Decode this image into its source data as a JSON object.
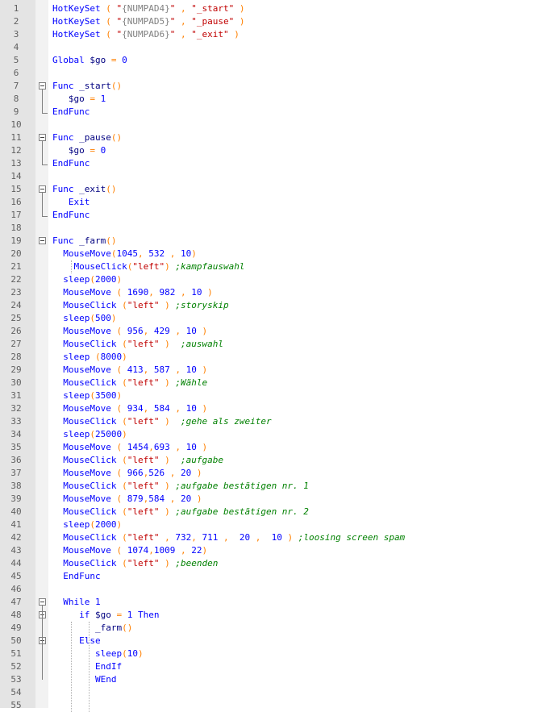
{
  "editor": {
    "lines": [
      {
        "n": "1",
        "parts": [
          [
            "k",
            "HotKeySet"
          ],
          [
            "sym",
            " ( "
          ],
          [
            "str",
            "\""
          ],
          [
            "grey",
            "{NUMPAD4}"
          ],
          [
            "str",
            "\""
          ],
          [
            "sym",
            " , "
          ],
          [
            "str",
            "\"_start\""
          ],
          [
            "sym",
            " )"
          ]
        ]
      },
      {
        "n": "2",
        "parts": [
          [
            "k",
            "HotKeySet"
          ],
          [
            "sym",
            " ( "
          ],
          [
            "str",
            "\""
          ],
          [
            "grey",
            "{NUMPAD5}"
          ],
          [
            "str",
            "\""
          ],
          [
            "sym",
            " , "
          ],
          [
            "str",
            "\"_pause\""
          ],
          [
            "sym",
            " )"
          ]
        ]
      },
      {
        "n": "3",
        "parts": [
          [
            "k",
            "HotKeySet"
          ],
          [
            "sym",
            " ( "
          ],
          [
            "str",
            "\""
          ],
          [
            "grey",
            "{NUMPAD6}"
          ],
          [
            "str",
            "\""
          ],
          [
            "sym",
            " , "
          ],
          [
            "str",
            "\"_exit\""
          ],
          [
            "sym",
            " )"
          ]
        ]
      },
      {
        "n": "4",
        "parts": []
      },
      {
        "n": "5",
        "parts": [
          [
            "k",
            "Global"
          ],
          [
            "var",
            " $go "
          ],
          [
            "sym",
            "="
          ],
          [
            "num",
            " 0"
          ]
        ]
      },
      {
        "n": "6",
        "parts": []
      },
      {
        "n": "7",
        "parts": [
          [
            "k",
            "Func"
          ],
          [
            "var",
            " _start"
          ],
          [
            "sym",
            "()"
          ]
        ]
      },
      {
        "n": "8",
        "parts": [
          [
            "var",
            "   $go "
          ],
          [
            "sym",
            "="
          ],
          [
            "num",
            " 1"
          ]
        ]
      },
      {
        "n": "9",
        "parts": [
          [
            "k",
            "EndFunc"
          ]
        ]
      },
      {
        "n": "10",
        "parts": []
      },
      {
        "n": "11",
        "parts": [
          [
            "k",
            "Func"
          ],
          [
            "var",
            " _pause"
          ],
          [
            "sym",
            "()"
          ]
        ]
      },
      {
        "n": "12",
        "parts": [
          [
            "var",
            "   $go "
          ],
          [
            "sym",
            "="
          ],
          [
            "num",
            " 0"
          ]
        ]
      },
      {
        "n": "13",
        "parts": [
          [
            "k",
            "EndFunc"
          ]
        ]
      },
      {
        "n": "14",
        "parts": []
      },
      {
        "n": "15",
        "parts": [
          [
            "k",
            "Func"
          ],
          [
            "var",
            " _exit"
          ],
          [
            "sym",
            "()"
          ]
        ]
      },
      {
        "n": "16",
        "parts": [
          [
            "k",
            "   Exit"
          ]
        ]
      },
      {
        "n": "17",
        "parts": [
          [
            "k",
            "EndFunc"
          ]
        ]
      },
      {
        "n": "18",
        "parts": []
      },
      {
        "n": "19",
        "parts": [
          [
            "k",
            "Func"
          ],
          [
            "var",
            " _farm"
          ],
          [
            "sym",
            "()"
          ]
        ]
      },
      {
        "n": "20",
        "parts": [
          [
            "k",
            "  MouseMove"
          ],
          [
            "sym",
            "("
          ],
          [
            "num",
            "1045"
          ],
          [
            "sym",
            ", "
          ],
          [
            "num",
            "532"
          ],
          [
            "sym",
            " , "
          ],
          [
            "num",
            "10"
          ],
          [
            "sym",
            ")"
          ]
        ]
      },
      {
        "n": "21",
        "parts": [
          [
            "k",
            "    MouseClick"
          ],
          [
            "sym",
            "("
          ],
          [
            "str",
            "\"left\""
          ],
          [
            "sym",
            ")"
          ],
          [
            "cmt",
            " ;kampfauswahl"
          ]
        ]
      },
      {
        "n": "22",
        "parts": [
          [
            "k",
            "  sleep"
          ],
          [
            "sym",
            "("
          ],
          [
            "num",
            "2000"
          ],
          [
            "sym",
            ")"
          ]
        ]
      },
      {
        "n": "23",
        "parts": [
          [
            "k",
            "  MouseMove"
          ],
          [
            "sym",
            " ( "
          ],
          [
            "num",
            "1690"
          ],
          [
            "sym",
            ", "
          ],
          [
            "num",
            "982"
          ],
          [
            "sym",
            " , "
          ],
          [
            "num",
            "10"
          ],
          [
            "sym",
            " )"
          ]
        ]
      },
      {
        "n": "24",
        "parts": [
          [
            "k",
            "  MouseClick"
          ],
          [
            "sym",
            " ("
          ],
          [
            "str",
            "\"left\""
          ],
          [
            "sym",
            " )"
          ],
          [
            "cmt",
            " ;storyskip"
          ]
        ]
      },
      {
        "n": "25",
        "parts": [
          [
            "k",
            "  sleep"
          ],
          [
            "sym",
            "("
          ],
          [
            "num",
            "500"
          ],
          [
            "sym",
            ")"
          ]
        ]
      },
      {
        "n": "26",
        "parts": [
          [
            "k",
            "  MouseMove"
          ],
          [
            "sym",
            " ( "
          ],
          [
            "num",
            "956"
          ],
          [
            "sym",
            ", "
          ],
          [
            "num",
            "429"
          ],
          [
            "sym",
            " , "
          ],
          [
            "num",
            "10"
          ],
          [
            "sym",
            " )"
          ]
        ]
      },
      {
        "n": "27",
        "parts": [
          [
            "k",
            "  MouseClick"
          ],
          [
            "sym",
            " ("
          ],
          [
            "str",
            "\"left\""
          ],
          [
            "sym",
            " )"
          ],
          [
            "cmt",
            "  ;auswahl"
          ]
        ]
      },
      {
        "n": "28",
        "parts": [
          [
            "k",
            "  sleep"
          ],
          [
            "sym",
            " ("
          ],
          [
            "num",
            "8000"
          ],
          [
            "sym",
            ")"
          ]
        ]
      },
      {
        "n": "29",
        "parts": [
          [
            "k",
            "  MouseMove"
          ],
          [
            "sym",
            " ( "
          ],
          [
            "num",
            "413"
          ],
          [
            "sym",
            ", "
          ],
          [
            "num",
            "587"
          ],
          [
            "sym",
            " , "
          ],
          [
            "num",
            "10"
          ],
          [
            "sym",
            " )"
          ]
        ]
      },
      {
        "n": "30",
        "parts": [
          [
            "k",
            "  MouseClick"
          ],
          [
            "sym",
            " ("
          ],
          [
            "str",
            "\"left\""
          ],
          [
            "sym",
            " )"
          ],
          [
            "cmt",
            " ;Wähle"
          ]
        ]
      },
      {
        "n": "31",
        "parts": [
          [
            "k",
            "  sleep"
          ],
          [
            "sym",
            "("
          ],
          [
            "num",
            "3500"
          ],
          [
            "sym",
            ")"
          ]
        ]
      },
      {
        "n": "32",
        "parts": [
          [
            "k",
            "  MouseMove"
          ],
          [
            "sym",
            " ( "
          ],
          [
            "num",
            "934"
          ],
          [
            "sym",
            ", "
          ],
          [
            "num",
            "584"
          ],
          [
            "sym",
            " , "
          ],
          [
            "num",
            "10"
          ],
          [
            "sym",
            " )"
          ]
        ]
      },
      {
        "n": "33",
        "parts": [
          [
            "k",
            "  MouseClick"
          ],
          [
            "sym",
            " ("
          ],
          [
            "str",
            "\"left\""
          ],
          [
            "sym",
            " )"
          ],
          [
            "cmt",
            "  ;gehe als zweiter"
          ]
        ]
      },
      {
        "n": "34",
        "parts": [
          [
            "k",
            "  sleep"
          ],
          [
            "sym",
            "("
          ],
          [
            "num",
            "25000"
          ],
          [
            "sym",
            ")"
          ]
        ]
      },
      {
        "n": "35",
        "parts": [
          [
            "k",
            "  MouseMove"
          ],
          [
            "sym",
            " ( "
          ],
          [
            "num",
            "1454"
          ],
          [
            "sym",
            ","
          ],
          [
            "num",
            "693"
          ],
          [
            "sym",
            " , "
          ],
          [
            "num",
            "10"
          ],
          [
            "sym",
            " )"
          ]
        ]
      },
      {
        "n": "36",
        "parts": [
          [
            "k",
            "  MouseClick"
          ],
          [
            "sym",
            " ("
          ],
          [
            "str",
            "\"left\""
          ],
          [
            "sym",
            " )"
          ],
          [
            "cmt",
            "  ;aufgabe"
          ]
        ]
      },
      {
        "n": "37",
        "parts": [
          [
            "k",
            "  MouseMove"
          ],
          [
            "sym",
            " ( "
          ],
          [
            "num",
            "966"
          ],
          [
            "sym",
            ","
          ],
          [
            "num",
            "526"
          ],
          [
            "sym",
            " , "
          ],
          [
            "num",
            "20"
          ],
          [
            "sym",
            " )"
          ]
        ]
      },
      {
        "n": "38",
        "parts": [
          [
            "k",
            "  MouseClick"
          ],
          [
            "sym",
            " ("
          ],
          [
            "str",
            "\"left\""
          ],
          [
            "sym",
            " )"
          ],
          [
            "cmt",
            " ;aufgabe bestätigen nr. 1"
          ]
        ]
      },
      {
        "n": "39",
        "parts": [
          [
            "k",
            "  MouseMove"
          ],
          [
            "sym",
            " ( "
          ],
          [
            "num",
            "879"
          ],
          [
            "sym",
            ","
          ],
          [
            "num",
            "584"
          ],
          [
            "sym",
            " , "
          ],
          [
            "num",
            "20"
          ],
          [
            "sym",
            " )"
          ]
        ]
      },
      {
        "n": "40",
        "parts": [
          [
            "k",
            "  MouseClick"
          ],
          [
            "sym",
            " ("
          ],
          [
            "str",
            "\"left\""
          ],
          [
            "sym",
            " )"
          ],
          [
            "cmt",
            " ;aufgabe bestätigen nr. 2"
          ]
        ]
      },
      {
        "n": "41",
        "parts": [
          [
            "k",
            "  sleep"
          ],
          [
            "sym",
            "("
          ],
          [
            "num",
            "2000"
          ],
          [
            "sym",
            ")"
          ]
        ]
      },
      {
        "n": "42",
        "parts": [
          [
            "k",
            "  MouseClick"
          ],
          [
            "sym",
            " ("
          ],
          [
            "str",
            "\"left\""
          ],
          [
            "sym",
            " , "
          ],
          [
            "num",
            "732"
          ],
          [
            "sym",
            ", "
          ],
          [
            "num",
            "711"
          ],
          [
            "sym",
            " ,  "
          ],
          [
            "num",
            "20"
          ],
          [
            "sym",
            " ,  "
          ],
          [
            "num",
            "10"
          ],
          [
            "sym",
            " )"
          ],
          [
            "cmt",
            " ;loosing screen spam"
          ]
        ]
      },
      {
        "n": "43",
        "parts": [
          [
            "k",
            "  MouseMove"
          ],
          [
            "sym",
            " ( "
          ],
          [
            "num",
            "1074"
          ],
          [
            "sym",
            ","
          ],
          [
            "num",
            "1009"
          ],
          [
            "sym",
            " , "
          ],
          [
            "num",
            "22"
          ],
          [
            "sym",
            ")"
          ]
        ]
      },
      {
        "n": "44",
        "parts": [
          [
            "k",
            "  MouseClick"
          ],
          [
            "sym",
            " ("
          ],
          [
            "str",
            "\"left\""
          ],
          [
            "sym",
            " )"
          ],
          [
            "cmt",
            " ;beenden"
          ]
        ]
      },
      {
        "n": "45",
        "parts": [
          [
            "k",
            "  EndFunc"
          ]
        ]
      },
      {
        "n": "46",
        "parts": []
      },
      {
        "n": "47",
        "parts": [
          [
            "k",
            "  While"
          ],
          [
            "num",
            " 1"
          ]
        ]
      },
      {
        "n": "48",
        "parts": [
          [
            "k",
            "     if"
          ],
          [
            "var",
            " $go "
          ],
          [
            "sym",
            "="
          ],
          [
            "num",
            " 1 "
          ],
          [
            "k",
            "Then"
          ]
        ]
      },
      {
        "n": "49",
        "parts": [
          [
            "var",
            "        _farm"
          ],
          [
            "sym",
            "()"
          ]
        ]
      },
      {
        "n": "50",
        "parts": [
          [
            "k",
            "     Else"
          ]
        ]
      },
      {
        "n": "51",
        "parts": [
          [
            "k",
            "        sleep"
          ],
          [
            "sym",
            "("
          ],
          [
            "num",
            "10"
          ],
          [
            "sym",
            ")"
          ]
        ]
      },
      {
        "n": "52",
        "parts": [
          [
            "k",
            "        EndIf"
          ]
        ]
      },
      {
        "n": "53",
        "parts": [
          [
            "k",
            "        WEnd"
          ]
        ]
      },
      {
        "n": "54",
        "parts": []
      },
      {
        "n": "55",
        "parts": []
      }
    ]
  },
  "colors": {
    "keyword": "#0000ff",
    "string": "#c00000",
    "operator": "#ff8000",
    "comment": "#008000",
    "macro": "#808080",
    "variable": "#000080",
    "gutter": "#e4e4e4"
  }
}
